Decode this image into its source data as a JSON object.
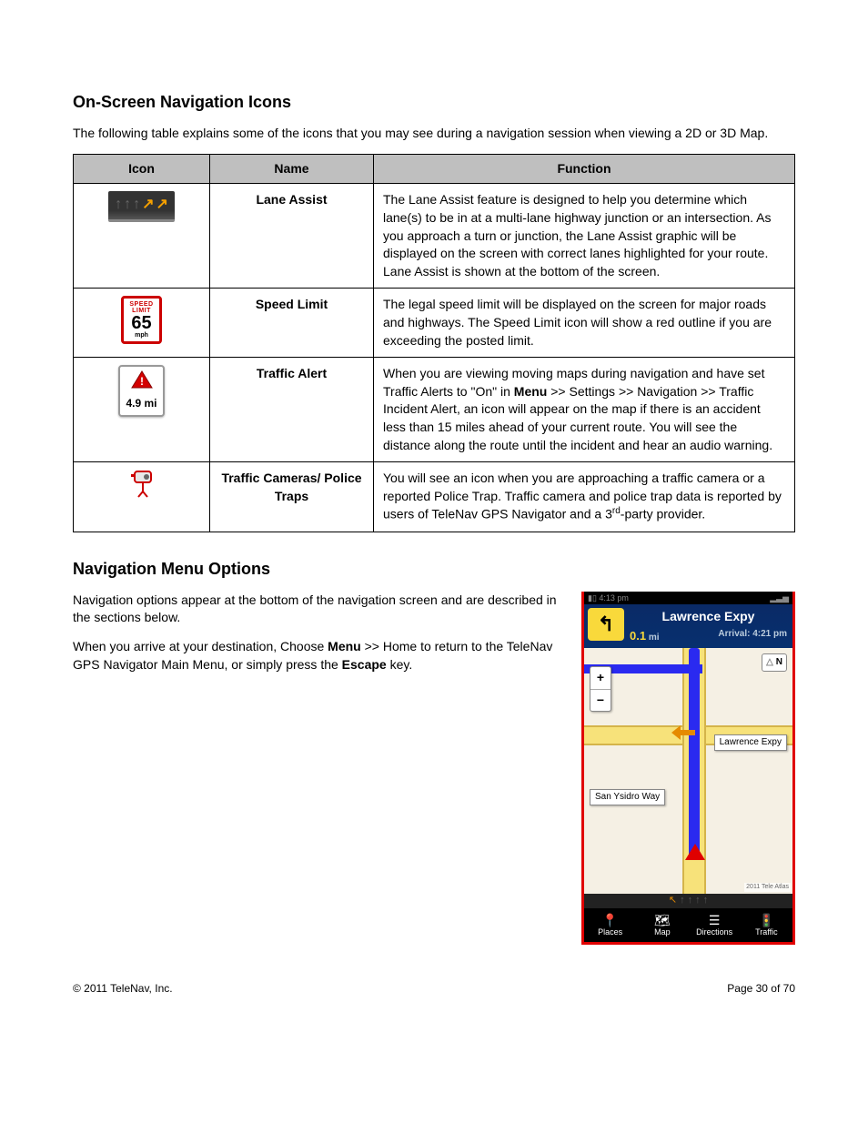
{
  "heading1": "On-Screen Navigation Icons",
  "intro1": "The following table explains some of the icons that you may see during a navigation session when viewing a 2D or 3D Map.",
  "table": {
    "headers": {
      "icon": "Icon",
      "name": "Name",
      "func": "Function"
    },
    "rows": [
      {
        "name": "Lane Assist",
        "func": "The Lane Assist feature is designed to help you determine which lane(s) to be in at a multi-lane highway junction or an intersection. As you approach a turn or junction, the Lane Assist graphic will be displayed on the screen with correct lanes highlighted for your route. Lane Assist is shown at the bottom of the screen."
      },
      {
        "name": "Speed Limit",
        "func": "The legal speed limit will be displayed on the screen for major roads and highways. The Speed Limit icon will show a red outline if you are exceeding the posted limit."
      },
      {
        "name": "Traffic Alert",
        "func_pre": "When you are viewing moving maps during navigation and have set Traffic Alerts to \"On\" in ",
        "func_bold": "Menu",
        "func_post": " >> Settings >> Navigation >> Traffic Incident Alert, an icon will appear on the map if there is an accident less than 15 miles ahead of your current route. You will see the distance along the route until the incident and hear an audio warning."
      },
      {
        "name": "Traffic Cameras/ Police Traps",
        "func_pre": "You will see an icon when you are approaching a traffic camera or a reported Police Trap. Traffic camera and police trap data is reported by users of TeleNav GPS Navigator and a 3",
        "func_sup": "rd",
        "func_post": "-party provider."
      }
    ]
  },
  "speed_sign": {
    "l1": "SPEED",
    "l2": "LIMIT",
    "val": "65",
    "unit": "mph"
  },
  "traffic_alert": {
    "dist": "4.9 mi"
  },
  "heading2": "Navigation Menu Options",
  "nav_p1": "Navigation options appear at the bottom of the navigation screen and are described in the sections below.",
  "nav_p2_pre": "When you arrive at your destination, Choose ",
  "nav_p2_b1": "Menu",
  "nav_p2_mid": " >> Home to return to the TeleNav GPS Navigator Main Menu, or simply press the ",
  "nav_p2_b2": "Escape",
  "nav_p2_post": " key.",
  "screenshot": {
    "time": "4:13 pm",
    "road": "Lawrence Expy",
    "dist": "0.1",
    "dist_unit": "mi",
    "arrival": "Arrival: 4:21 pm",
    "label1": "Lawrence Expy",
    "label2": "San Ysidro Way",
    "map_copy": "2011 Tele Atlas",
    "north": "N",
    "nav_items": [
      "Places",
      "Map",
      "Directions",
      "Traffic"
    ]
  },
  "footer": {
    "copyright": "© 2011 TeleNav, Inc.",
    "page": "Page 30 of 70"
  }
}
